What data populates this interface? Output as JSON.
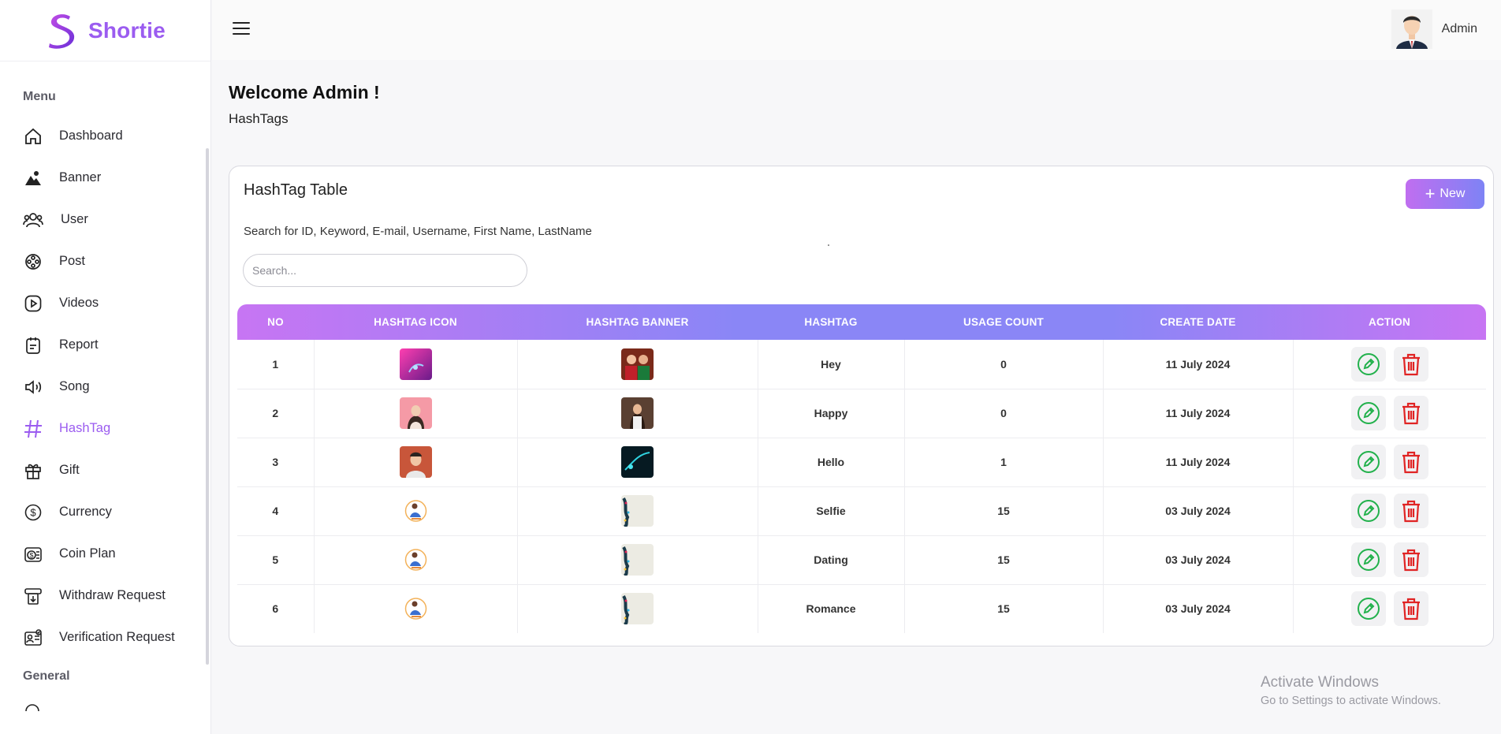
{
  "app": {
    "name": "Shortie"
  },
  "sidebar": {
    "menu_title": "Menu",
    "items": [
      {
        "label": "Dashboard",
        "icon": "home-icon"
      },
      {
        "label": "Banner",
        "icon": "banner-icon"
      },
      {
        "label": "User",
        "icon": "users-icon"
      },
      {
        "label": "Post",
        "icon": "film-reel-icon"
      },
      {
        "label": "Videos",
        "icon": "play-icon"
      },
      {
        "label": "Report",
        "icon": "report-icon"
      },
      {
        "label": "Song",
        "icon": "speaker-icon"
      },
      {
        "label": "HashTag",
        "icon": "hashtag-icon",
        "active": true
      },
      {
        "label": "Gift",
        "icon": "gift-icon"
      },
      {
        "label": "Currency",
        "icon": "dollar-icon"
      },
      {
        "label": "Coin Plan",
        "icon": "coin-plan-icon"
      },
      {
        "label": "Withdraw Request",
        "icon": "withdraw-icon"
      },
      {
        "label": "Verification Request",
        "icon": "verification-icon"
      }
    ],
    "general_title": "General"
  },
  "header": {
    "admin_name": "Admin"
  },
  "page": {
    "welcome": "Welcome Admin !",
    "breadcrumb": "HashTags"
  },
  "card": {
    "title": "HashTag Table",
    "new_label": "New",
    "search_hint": "Search for ID, Keyword, E-mail, Username, First Name, LastName",
    "search_placeholder": "Search..."
  },
  "table": {
    "headers": [
      "NO",
      "HASHTAG ICON",
      "HASHTAG BANNER",
      "HASHTAG",
      "USAGE COUNT",
      "CREATE DATE",
      "ACTION"
    ],
    "rows": [
      {
        "no": "1",
        "hashtag": "Hey",
        "usage": "0",
        "date": "11 July 2024"
      },
      {
        "no": "2",
        "hashtag": "Happy",
        "usage": "0",
        "date": "11 July 2024"
      },
      {
        "no": "3",
        "hashtag": "Hello",
        "usage": "1",
        "date": "11 July 2024"
      },
      {
        "no": "4",
        "hashtag": "Selfie",
        "usage": "15",
        "date": "03 July 2024"
      },
      {
        "no": "5",
        "hashtag": "Dating",
        "usage": "15",
        "date": "03 July 2024"
      },
      {
        "no": "6",
        "hashtag": "Romance",
        "usage": "15",
        "date": "03 July 2024"
      }
    ]
  },
  "watermark": {
    "line1": "Activate Windows",
    "line2": "Go to Settings to activate Windows."
  },
  "colors": {
    "accent": "#9b5cf0",
    "edit": "#22b14c",
    "delete": "#e02424"
  }
}
